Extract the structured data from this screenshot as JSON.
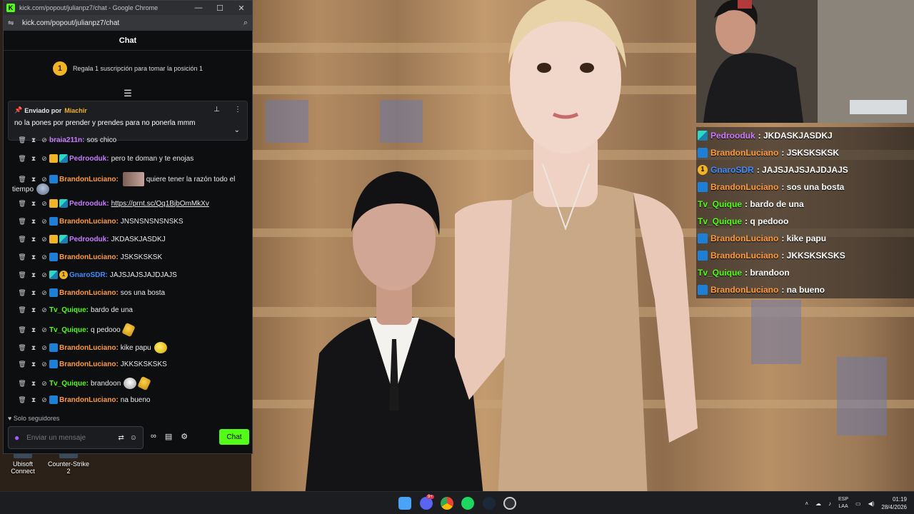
{
  "browser": {
    "title": "kick.com/popout/julianpz7/chat - Google Chrome",
    "url": "kick.com/popout/julianpz7/chat",
    "controls": {
      "minimize": "—",
      "maximize": "☐",
      "close": "✕"
    }
  },
  "chat": {
    "header": "Chat",
    "sub_goal": {
      "rank": "1",
      "text": "Regala 1 suscripción para tomar la posición 1"
    },
    "pinned": {
      "label": "Enviado por",
      "author": "Miachir",
      "message": "no la pones por prender y prendes para no ponerla mmm"
    },
    "messages": [
      {
        "user": "braia211n",
        "color": "purple",
        "badges": [],
        "text": "sos chico"
      },
      {
        "user": "Pedrooduk",
        "color": "purple",
        "badges": [
          "crown",
          "og"
        ],
        "text": "pero te doman y te enojas"
      },
      {
        "user": "BrandonLuciano",
        "color": "orange",
        "badges": [
          "sub"
        ],
        "text": "quiere tener la razón todo el",
        "text2": "tiempo"
      },
      {
        "user": "Pedrooduk",
        "color": "purple",
        "badges": [
          "crown",
          "og"
        ],
        "text": "https://prnt.sc/Qq1BjbOmMkXv"
      },
      {
        "user": "BrandonLuciano",
        "color": "orange",
        "badges": [
          "sub"
        ],
        "text": "JNSNSNSNSNSKS"
      },
      {
        "user": "Pedrooduk",
        "color": "purple",
        "badges": [
          "crown",
          "og"
        ],
        "text": "JKDASKJASDKJ"
      },
      {
        "user": "BrandonLuciano",
        "color": "orange",
        "badges": [
          "sub"
        ],
        "text": "JSKSKSKSK"
      },
      {
        "user": "GnaroSDR",
        "color": "blue",
        "badges": [
          "og",
          "one"
        ],
        "text": "JAJSJAJSJAJDJAJS"
      },
      {
        "user": "BrandonLuciano",
        "color": "orange",
        "badges": [
          "sub"
        ],
        "text": "sos una bosta"
      },
      {
        "user": "Tv_Quique",
        "color": "green",
        "badges": [],
        "text": "bardo de una"
      },
      {
        "user": "Tv_Quique",
        "color": "green",
        "badges": [],
        "text": "q pedooo"
      },
      {
        "user": "BrandonLuciano",
        "color": "orange",
        "badges": [
          "sub"
        ],
        "text": "kike papu"
      },
      {
        "user": "BrandonLuciano",
        "color": "orange",
        "badges": [
          "sub"
        ],
        "text": "JKKSKSKSKS"
      },
      {
        "user": "Tv_Quique",
        "color": "green",
        "badges": [],
        "text": "brandoon"
      },
      {
        "user": "BrandonLuciano",
        "color": "orange",
        "badges": [
          "sub"
        ],
        "text": "na bueno"
      }
    ],
    "followers_only": "Solo seguidores",
    "input_placeholder": "Enviar un mensaje",
    "send_label": "Chat"
  },
  "desktop_icons": [
    {
      "label": "Ubisoft Connect"
    },
    {
      "label": "Counter-Strike 2"
    }
  ],
  "overlay_chat": [
    {
      "user": "Pedrooduk",
      "color": "#c97bff",
      "badge": "og",
      "text": "JKDASKJASDKJ"
    },
    {
      "user": "BrandonLuciano",
      "color": "#ff9b3c",
      "badge": "sub",
      "text": "JSKSKSKSK"
    },
    {
      "user": "GnaroSDR",
      "color": "#3f8cff",
      "badge": "one",
      "text": "JAJSJAJSJAJDJAJS"
    },
    {
      "user": "BrandonLuciano",
      "color": "#ff9b3c",
      "badge": "sub",
      "text": "sos una bosta"
    },
    {
      "user": "Tv_Quique",
      "color": "#53fc18",
      "badge": "",
      "text": "bardo de una"
    },
    {
      "user": "Tv_Quique",
      "color": "#53fc18",
      "badge": "",
      "text": "q pedooo"
    },
    {
      "user": "BrandonLuciano",
      "color": "#ff9b3c",
      "badge": "sub",
      "text": "kike papu"
    },
    {
      "user": "BrandonLuciano",
      "color": "#ff9b3c",
      "badge": "sub",
      "text": "JKKSKSKSKS"
    },
    {
      "user": "Tv_Quique",
      "color": "#53fc18",
      "badge": "",
      "text": "brandoon"
    },
    {
      "user": "BrandonLuciano",
      "color": "#ff9b3c",
      "badge": "sub",
      "text": "na bueno"
    }
  ],
  "taskbar": {
    "apps": [
      "windows-start",
      "discord",
      "chrome",
      "spotify",
      "steam",
      "obs"
    ],
    "discord_badge": "9+",
    "language": "ESP",
    "layout": "LAA",
    "time": "01:19",
    "date": "28/4/2026"
  }
}
